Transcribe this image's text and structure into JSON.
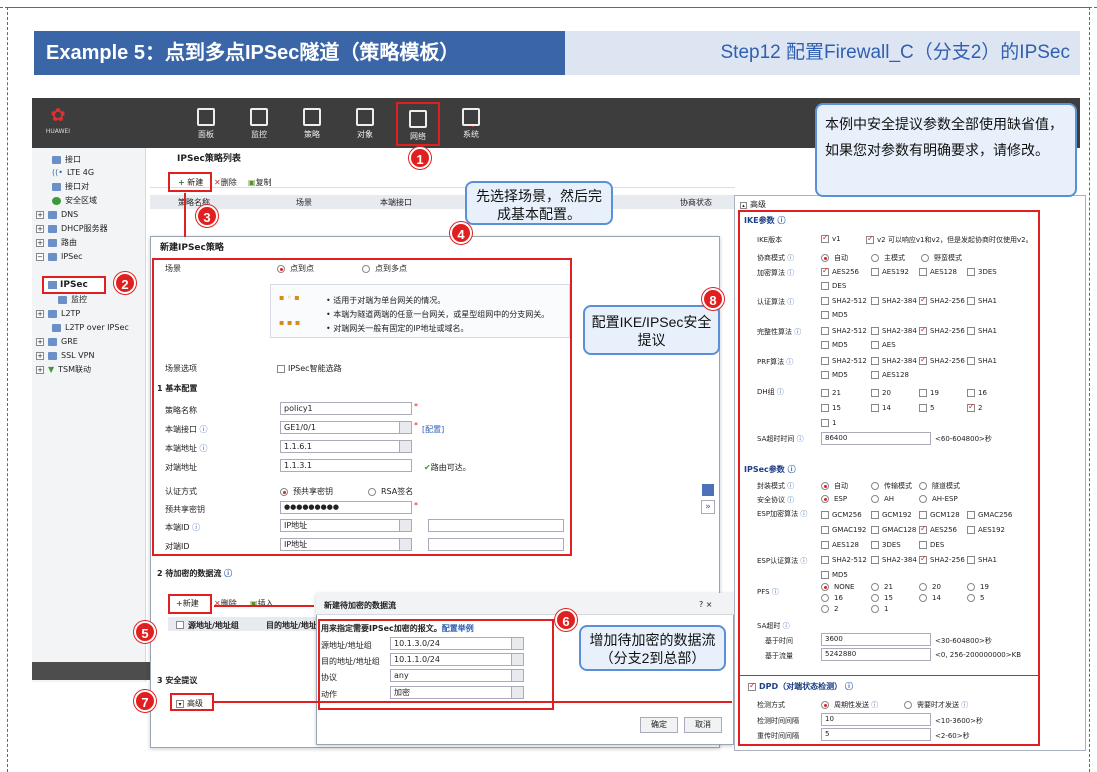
{
  "slide": {
    "title": "Example 5：点到多点IPSec隧道（策略模板）",
    "step": "Step12 配置Firewall_C（分支2）的IPSec"
  },
  "topbar": {
    "logo_text": "HUAWEI",
    "nav": [
      "面板",
      "监控",
      "策略",
      "对象",
      "网络",
      "系统"
    ],
    "active_nav": "网络"
  },
  "sidebar": {
    "items": [
      "接口",
      "LTE 4G",
      "接口对",
      "安全区域",
      "DNS",
      "DHCP服务器",
      "路由",
      "IPSec",
      "IPSec",
      "监控",
      "L2TP",
      "L2TP over IPSec",
      "GRE",
      "SSL VPN",
      "TSM联动"
    ]
  },
  "list": {
    "title": "IPSec策略列表",
    "toolbar": {
      "new": "新建",
      "delete": "删除",
      "copy": "复制"
    },
    "columns": [
      "策略名称",
      "场景",
      "本端接口",
      "协商状态"
    ]
  },
  "dialog": {
    "title": "新建IPSec策略",
    "scene_label": "场景",
    "scene_options": [
      "点到点",
      "点到多点"
    ],
    "scene_desc": [
      "适用于对端为单台网关的情况。",
      "本端为隧道两端的任意一台网关，或星型组网中的分支网关。",
      "对端网关一般有固定的IP地址或域名。"
    ],
    "scene_option_label": "场景选项",
    "smart_route": "IPSec智能选路",
    "basic_section": "基本配置",
    "fields": [
      {
        "label": "策略名称",
        "value": "policy1"
      },
      {
        "label": "本端接口",
        "value": "GE1/0/1",
        "link": "[配置]"
      },
      {
        "label": "本端地址",
        "value": "1.1.6.1"
      },
      {
        "label": "对端地址",
        "value": "1.1.3.1",
        "note": "路由可达。"
      }
    ],
    "auth_label": "认证方式",
    "auth_options": [
      "预共享密钥",
      "RSA签名"
    ],
    "psk_label": "预共享密钥",
    "psk_value": "●●●●●●●●●",
    "local_id_label": "本端ID",
    "local_id_value": "IP地址",
    "peer_id_label": "对端ID",
    "peer_id_value": "IP地址",
    "flow_section": "待加密的数据流",
    "flow_toolbar": {
      "new": "新建",
      "delete": "删除",
      "insert": "插入"
    },
    "flow_columns": [
      "源地址/地址组",
      "目的地址/地址"
    ],
    "security_section": "安全提议",
    "advanced": "高级"
  },
  "sub_dialog": {
    "title": "新建待加密的数据流",
    "controls": "?  ×",
    "hint": "用来指定需要IPSec加密的报文。",
    "hint_link": "配置举例",
    "rows": [
      {
        "label": "源地址/地址组",
        "value": "10.1.3.0/24"
      },
      {
        "label": "目的地址/地址组",
        "value": "10.1.1.0/24"
      },
      {
        "label": "协议",
        "value": "any"
      },
      {
        "label": "动作",
        "value": "加密"
      }
    ],
    "ok": "确定",
    "cancel": "取消"
  },
  "advanced": {
    "header": "高级",
    "ike_title": "IKE参数",
    "ike_version_label": "IKE版本",
    "ike_v1": "v1",
    "ike_v2": "v2",
    "ike_version_note": "可以响应v1和v2，但是发起协商时仅使用v2。",
    "negotiation_label": "协商模式",
    "negotiation_options": [
      "自动",
      "主模式",
      "野蛮模式"
    ],
    "enc_label": "加密算法",
    "enc_options": [
      "AES256",
      "AES192",
      "AES128",
      "3DES",
      "DES"
    ],
    "auth_alg_label": "认证算法",
    "auth_alg_options": [
      "SHA2-512",
      "SHA2-384",
      "SHA2-256",
      "SHA1",
      "MD5"
    ],
    "integrity_label": "完整性算法",
    "integrity_options": [
      "SHA2-512",
      "SHA2-384",
      "SHA2-256",
      "SHA1",
      "MD5",
      "AES"
    ],
    "prf_label": "PRF算法",
    "prf_options": [
      "SHA2-512",
      "SHA2-384",
      "SHA2-256",
      "SHA1",
      "MD5",
      "AES128"
    ],
    "dh_label": "DH组",
    "dh_options": [
      "21",
      "20",
      "19",
      "16",
      "15",
      "14",
      "5",
      "2",
      "1"
    ],
    "sa_time_label": "SA超时时间",
    "sa_time_value": "86400",
    "sa_time_note": "<60-604800>秒",
    "ipsec_title": "IPSec参数",
    "encap_label": "封装模式",
    "encap_options": [
      "自动",
      "传输模式",
      "隧道模式"
    ],
    "proto_label": "安全协议",
    "proto_options": [
      "ESP",
      "AH",
      "AH-ESP"
    ],
    "esp_enc_label": "ESP加密算法",
    "esp_enc_options": [
      "GCM256",
      "GCM192",
      "GCM128",
      "GMAC256",
      "GMAC192",
      "GMAC128",
      "AES256",
      "AES192",
      "AES128",
      "3DES",
      "DES"
    ],
    "esp_auth_label": "ESP认证算法",
    "esp_auth_options": [
      "SHA2-512",
      "SHA2-384",
      "SHA2-256",
      "SHA1",
      "MD5"
    ],
    "pfs_label": "PFS",
    "pfs_options": [
      "NONE",
      "21",
      "20",
      "19",
      "16",
      "15",
      "14",
      "5",
      "2",
      "1"
    ],
    "sa_label": "SA超时",
    "base_time_label": "基于时间",
    "base_time_value": "3600",
    "base_time_note": "<30-604800>秒",
    "base_flow_label": "基于流量",
    "base_flow_value": "5242880",
    "base_flow_note": "<0, 256-200000000>KB",
    "dpd_title": "DPD（对端状态检测）",
    "dpd_mode_label": "检测方式",
    "dpd_mode_options": [
      "周期性发送",
      "需要时才发送"
    ],
    "dpd_interval_label": "检测时间间隔",
    "dpd_interval_value": "10",
    "dpd_interval_note": "<10-3600>秒",
    "dpd_retry_label": "重传时间间隔",
    "dpd_retry_value": "5",
    "dpd_retry_note": "<2-60>秒"
  },
  "callouts": {
    "top_note": "本例中安全提议参数全部使用缺省值，如果您对参数有明确要求，请修改。",
    "c4": "先选择场景，然后完成基本配置。",
    "c6": "增加待加密的数据流（分支2到总部）",
    "c8": "配置IKE/IPSec安全提议"
  },
  "steps": [
    "1",
    "2",
    "3",
    "4",
    "5",
    "6",
    "7",
    "8"
  ],
  "colors": {
    "accent": "#3a66a8",
    "highlight": "#e02020",
    "callout": "#5b8fd6"
  }
}
